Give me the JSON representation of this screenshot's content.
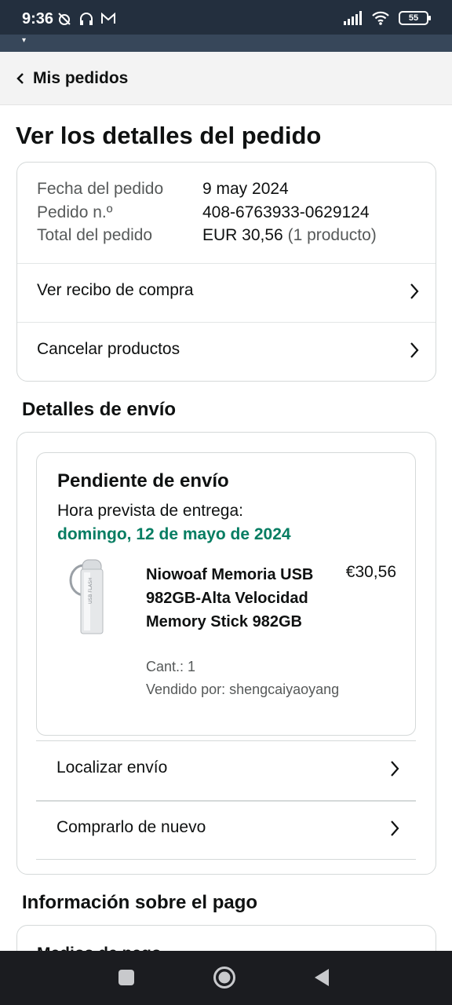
{
  "status_bar": {
    "time": "9:36",
    "icons_left": [
      "alarm-off-icon",
      "headphones-icon",
      "gmail-icon"
    ],
    "icons_right": [
      "signal-icon",
      "wifi-icon"
    ],
    "battery": "55"
  },
  "header": {
    "back_icon": "chevron-left-icon",
    "title": "Mis pedidos"
  },
  "page_title": "Ver los detalles del pedido",
  "order_summary": {
    "rows": [
      {
        "label": "Fecha del pedido",
        "value": "9 may 2024"
      },
      {
        "label": "Pedido n.º",
        "value": "408-6763933-0629124"
      },
      {
        "label": "Total del pedido",
        "value": "EUR 30,56",
        "note": "(1 producto)"
      }
    ],
    "links": [
      {
        "label": "Ver recibo de compra"
      },
      {
        "label": "Cancelar productos"
      }
    ]
  },
  "shipping": {
    "section_title": "Detalles de envío",
    "status": "Pendiente de envío",
    "eta_label": "Hora prevista de entrega:",
    "eta_date": "domingo, 12 de mayo de 2024",
    "product": {
      "name": "Niowoaf Memoria USB 982GB-Alta Velocidad Memory Stick 982GB",
      "price": "€30,56",
      "qty": "Cant.: 1",
      "seller": "Vendido por: shengcaiyaoyang"
    },
    "links": [
      {
        "label": "Localizar envío"
      },
      {
        "label": "Comprarlo de nuevo"
      }
    ]
  },
  "payment": {
    "section_title": "Información sobre el pago",
    "first_item": "Medios de pago"
  },
  "colors": {
    "status_bar": "#232f3e",
    "eta_green": "#067d62",
    "nav_bar": "#1b1c20"
  }
}
